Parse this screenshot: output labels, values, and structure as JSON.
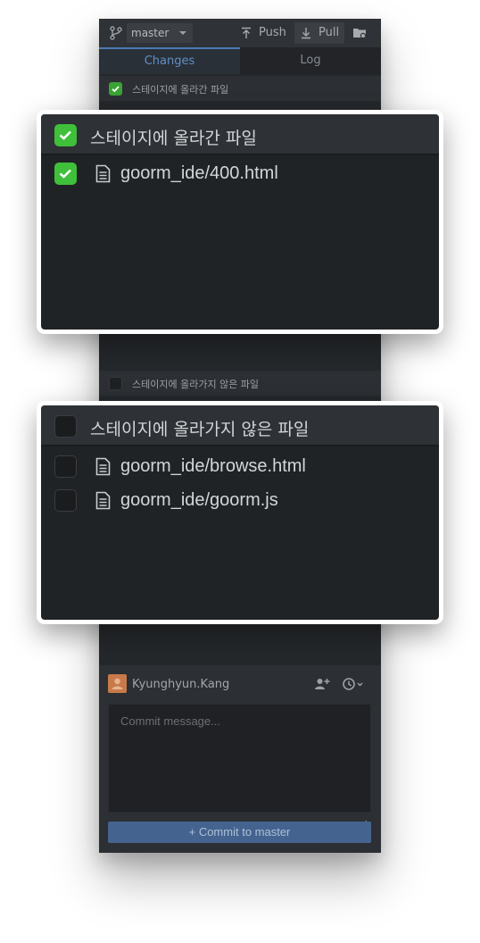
{
  "toolbar": {
    "branch": "master",
    "push_label": "Push",
    "pull_label": "Pull"
  },
  "tabs": [
    {
      "label": "Changes",
      "active": true
    },
    {
      "label": "Log",
      "active": false
    }
  ],
  "staged": {
    "label": "스테이지에 올라간 파일",
    "checked": true,
    "files": [
      {
        "name": "goorm_ide/400.html",
        "checked": true
      }
    ]
  },
  "unstaged": {
    "label": "스테이지에 올라가지 않은 파일",
    "checked": false,
    "files": [
      {
        "name": "goorm_ide/browse.html",
        "checked": false
      },
      {
        "name": "goorm_ide/goorm.js",
        "checked": false
      }
    ]
  },
  "commit": {
    "author": "Kyunghyun.Kang",
    "message_placeholder": "Commit message...",
    "button_label": "Commit to master"
  },
  "colors": {
    "accent_blue": "#4a7ab5",
    "check_green": "#3fbf3a",
    "panel_bg": "#25282b"
  }
}
